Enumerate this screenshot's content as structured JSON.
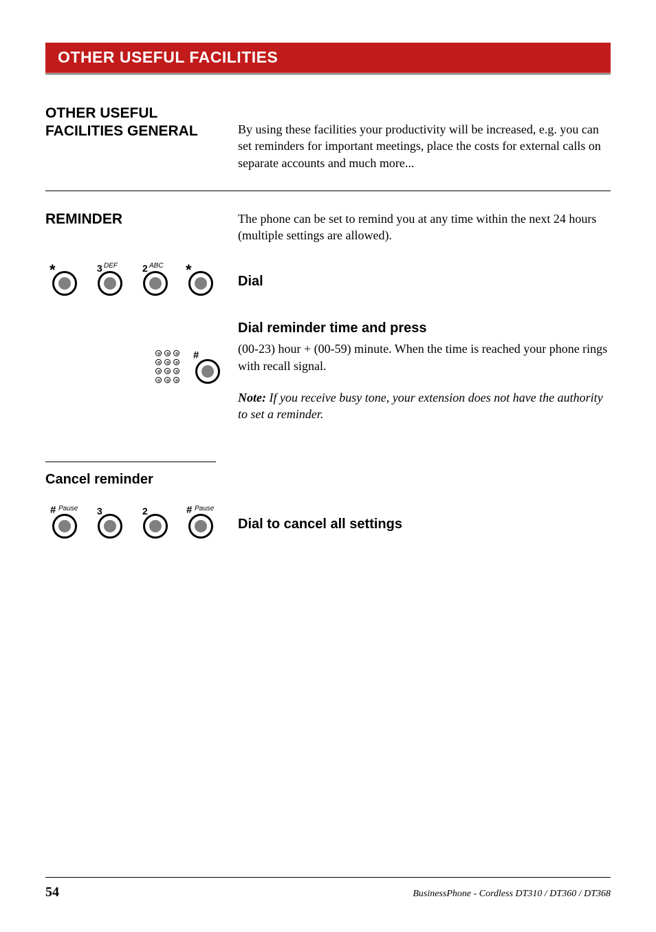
{
  "header": {
    "title": "OTHER USEFUL FACILITIES"
  },
  "section1": {
    "heading_line1": "OTHER USEFUL",
    "heading_line2": "FACILITIES GENERAL",
    "body": "By using these facilities your productivity will be increased, e.g. you can set reminders for important meetings, place the costs for external calls on separate accounts and much more..."
  },
  "section2": {
    "heading": "REMINDER",
    "body": "The phone can be set to remind you at any time within the next 24 hours (multiple settings are allowed)."
  },
  "keys1": {
    "k1_sym": "*",
    "k2_digit": "3",
    "k2_sup": "DEF",
    "k3_digit": "2",
    "k3_sup": "ABC",
    "k4_sym": "*",
    "label": "Dial"
  },
  "keys2": {
    "k_hash": "#",
    "title": "Dial reminder time and press",
    "body": "(00-23) hour + (00-59) minute. When the time is reached your phone rings with recall signal.",
    "note_label": "Note:",
    "note_body": " If you receive busy tone, your extension does not have the authority to set a reminder."
  },
  "cancel": {
    "heading": "Cancel reminder",
    "k1_sym": "#",
    "k1_sup": "Pause",
    "k2_digit": "3",
    "k3_digit": "2",
    "k4_sym": "#",
    "k4_sup": "Pause",
    "label": "Dial to cancel all settings"
  },
  "footer": {
    "page": "54",
    "product": "BusinessPhone - Cordless DT310 / DT360 / DT368"
  }
}
